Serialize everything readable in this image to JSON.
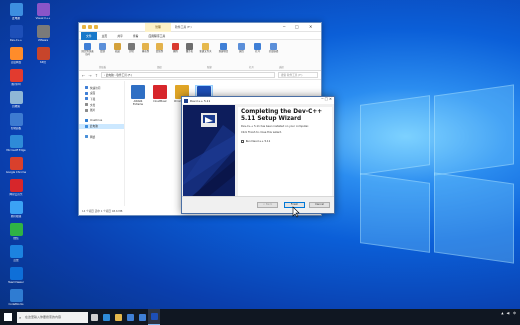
{
  "desktop": {
    "icons": [
      {
        "label": "此电脑",
        "color": "#3d8fe0"
      },
      {
        "label": "Dev-C++",
        "color": "#1d4fb8"
      },
      {
        "label": "百度网盘",
        "color": "#ff8c2a"
      },
      {
        "label": "腾讯QQ",
        "color": "#e23b2f"
      },
      {
        "label": "回收站",
        "color": "#8fb7d6"
      },
      {
        "label": "控制面板",
        "color": "#3d7bd1"
      },
      {
        "label": "Microsoft Edge",
        "color": "#2e8bd8"
      },
      {
        "label": "Google Chrome",
        "color": "#d9402c"
      },
      {
        "label": "网易云音乐",
        "color": "#d7262b"
      },
      {
        "label": "腾讯视频",
        "color": "#3ba2f5"
      },
      {
        "label": "微信",
        "color": "#2fb344"
      },
      {
        "label": "迅雷",
        "color": "#1c83e0"
      },
      {
        "label": "TeamViewer",
        "color": "#0e6fd8"
      },
      {
        "label": "CodeBlocks",
        "color": "#2f7cd2"
      },
      {
        "label": "Visual C++",
        "color": "#8a55c8"
      },
      {
        "label": "VMware",
        "color": "#7a7a7a"
      },
      {
        "label": "64位",
        "color": "#c7452b"
      }
    ]
  },
  "explorer": {
    "manage_tab": "管理",
    "window_title": "软件工具 (F:)",
    "min": "─",
    "max": "□",
    "close": "✕",
    "ribbon_tabs": [
      "文件",
      "主页",
      "共享",
      "查看",
      "应用程序工具"
    ],
    "ribbon_items": [
      {
        "label": "固定到快速访问",
        "color": "#3f7fd6"
      },
      {
        "label": "复制",
        "color": "#5b8fd9"
      },
      {
        "label": "粘贴",
        "color": "#d4a13a"
      },
      {
        "label": "剪切",
        "color": "#777777"
      },
      {
        "label": "移动到",
        "color": "#e3b24b"
      },
      {
        "label": "复制到",
        "color": "#e3b24b"
      },
      {
        "label": "删除",
        "color": "#d93a2f"
      },
      {
        "label": "重命名",
        "color": "#6d6d6d"
      },
      {
        "label": "新建文件夹",
        "color": "#e6b94d"
      },
      {
        "label": "新建项目",
        "color": "#3f7fd6"
      },
      {
        "label": "属性",
        "color": "#5b8fd9"
      },
      {
        "label": "打开",
        "color": "#3f7fd6"
      },
      {
        "label": "全部选择",
        "color": "#5b8fd9"
      }
    ],
    "ribbon_groups": [
      "剪贴板",
      "组织",
      "新建",
      "打开",
      "选择"
    ],
    "address": "› 此电脑 › 软件工具 (F:)",
    "search_placeholder": "搜索 软件工具 (F:)",
    "nav_items": [
      {
        "label": "快速访问",
        "color": "#3f7fd6"
      },
      {
        "label": "桌面",
        "color": "#3f7fd6"
      },
      {
        "label": "下载",
        "color": "#3f7fd6"
      },
      {
        "label": "文档",
        "color": "#8c8c8c"
      },
      {
        "label": "图片",
        "color": "#8c8c8c"
      },
      {
        "label": "OneDrive",
        "color": "#2b7cd3"
      },
      {
        "label": "此电脑",
        "color": "#3d8fe0"
      },
      {
        "label": "网络",
        "color": "#4a90d9"
      }
    ],
    "files": [
      {
        "name": "AIDA64 Extreme",
        "color": "#2f6fc4"
      },
      {
        "name": "CloudMusic",
        "color": "#d7262b"
      },
      {
        "name": "ChromeSetup",
        "color": "#e0a526"
      },
      {
        "name": "Dev-Cpp 5.11 TDM-GCC 4.9.2 Setup",
        "color": "#1d4fb8"
      }
    ],
    "status": "14 个项目   选中 1 个项目 48.6 MB"
  },
  "setup": {
    "title": "Dev-C++ 5.11",
    "heading": "Completing the Dev-C++ 5.11 Setup Wizard",
    "line1": "Dev-C++ 5.11 has been installed on your computer.",
    "line2": "Click Finish to close this wizard.",
    "checkbox_label": "Run Dev-C++ 5.11",
    "checkbox_checked": true,
    "back_button": "< Back",
    "finish_button": "Finish",
    "cancel_button": "Cancel"
  },
  "taskbar": {
    "search_placeholder": "在这里输入你要搜索的内容",
    "apps": [
      {
        "name": "task-view",
        "color": "#d0d0d0"
      },
      {
        "name": "edge",
        "color": "#2e8bd8"
      },
      {
        "name": "file-explorer",
        "color": "#e6b94d"
      },
      {
        "name": "store",
        "color": "#3f7fd6"
      },
      {
        "name": "mail",
        "color": "#3f7fd6"
      },
      {
        "name": "dev-c-installer",
        "color": "#1d4fb8"
      }
    ],
    "tray_text": "中"
  }
}
